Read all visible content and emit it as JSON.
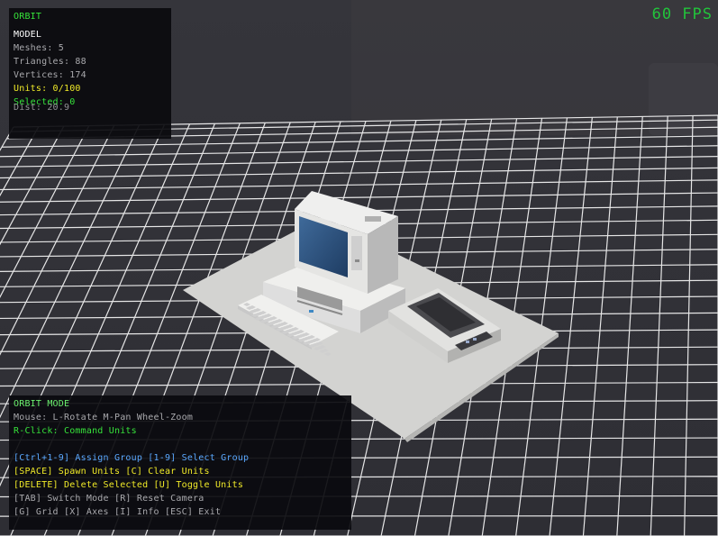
{
  "fps_label": "60 FPS",
  "stats": {
    "mode_title": "ORBIT",
    "section": "MODEL",
    "meshes": "Meshes: 5",
    "triangles": "Triangles: 88",
    "vertices": "Vertices: 174",
    "units": "Units: 0/100",
    "selected": "Selected: 0",
    "dist": "Dist: 20.9"
  },
  "help": {
    "title": "ORBIT MODE",
    "mouse": "Mouse: L-Rotate M-Pan Wheel-Zoom",
    "rclick": "R-Click: Command Units",
    "groups": "[Ctrl+1-9] Assign Group  [1-9] Select Group",
    "spawn": "[SPACE] Spawn Units  [C] Clear Units",
    "delete": "[DELETE] Delete Selected  [U] Toggle Units",
    "tab": "[TAB] Switch Mode  [R] Reset Camera",
    "keys": "[G] Grid  [X] Axes  [I] Info  [ESC] Exit"
  },
  "colors": {
    "background": "#3a3a40",
    "grid": "#ffffff",
    "hud_green": "#36e23a",
    "hud_yellow": "#f0ea28",
    "hud_blue": "#5aa8ff",
    "fps_green": "#22c33b"
  }
}
